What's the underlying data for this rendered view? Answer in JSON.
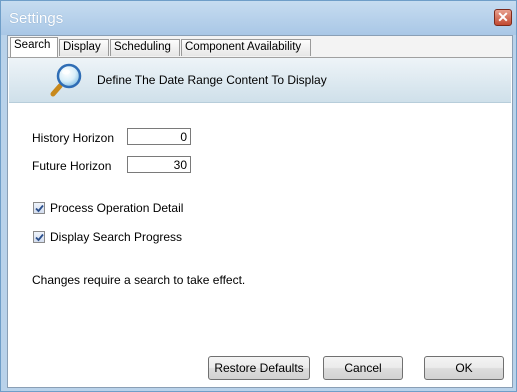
{
  "window": {
    "title": "Settings",
    "close_glyph": "✕"
  },
  "tabs": [
    {
      "label": "Search",
      "active": true
    },
    {
      "label": "Display",
      "active": false
    },
    {
      "label": "Scheduling",
      "active": false
    },
    {
      "label": "Component Availability",
      "active": false
    }
  ],
  "banner": {
    "icon": "magnifier-icon",
    "text": "Define The Date Range Content To Display"
  },
  "fields": {
    "history_horizon": {
      "label": "History Horizon",
      "value": "0"
    },
    "future_horizon": {
      "label": "Future Horizon",
      "value": "30"
    }
  },
  "checkboxes": {
    "process_operation_detail": {
      "label": "Process Operation Detail",
      "checked": true
    },
    "display_search_progress": {
      "label": "Display Search Progress",
      "checked": true
    }
  },
  "note": "Changes require a search to take effect.",
  "buttons": {
    "restore_defaults": "Restore Defaults",
    "cancel": "Cancel",
    "ok": "OK"
  },
  "colors": {
    "title_bar": "#b9d2ea",
    "close_button": "#c24a32",
    "banner": "#dbe8f0",
    "check_mark": "#2b4f8c"
  }
}
